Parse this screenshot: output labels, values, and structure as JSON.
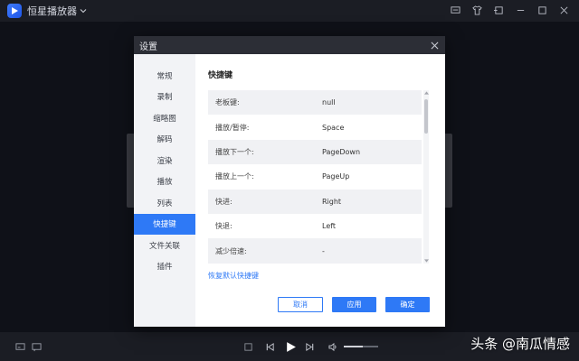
{
  "app": {
    "title": "恒星播放器"
  },
  "dialog": {
    "title": "设置",
    "nav": [
      {
        "label": "常规",
        "active": false
      },
      {
        "label": "录制",
        "active": false
      },
      {
        "label": "缩略图",
        "active": false
      },
      {
        "label": "解码",
        "active": false
      },
      {
        "label": "渲染",
        "active": false
      },
      {
        "label": "播放",
        "active": false
      },
      {
        "label": "列表",
        "active": false
      },
      {
        "label": "快捷键",
        "active": true
      },
      {
        "label": "文件关联",
        "active": false
      },
      {
        "label": "插件",
        "active": false
      }
    ],
    "section_title": "快捷键",
    "shortcuts": [
      {
        "name": "老板键:",
        "key": "null"
      },
      {
        "name": "播放/暂停:",
        "key": "Space"
      },
      {
        "name": "播放下一个:",
        "key": "PageDown"
      },
      {
        "name": "播放上一个:",
        "key": "PageUp"
      },
      {
        "name": "快进:",
        "key": "Right"
      },
      {
        "name": "快退:",
        "key": "Left"
      },
      {
        "name": "减少倍速:",
        "key": "-"
      }
    ],
    "restore_default": "恢复默认快捷键",
    "buttons": {
      "cancel": "取消",
      "apply": "应用",
      "ok": "确定"
    }
  },
  "player": {
    "volume_level": 0.55
  },
  "watermark": "头条 @南瓜情感",
  "colors": {
    "accent": "#2e79f6",
    "titlebar": "#2c2e36",
    "background": "#1b1d24"
  }
}
